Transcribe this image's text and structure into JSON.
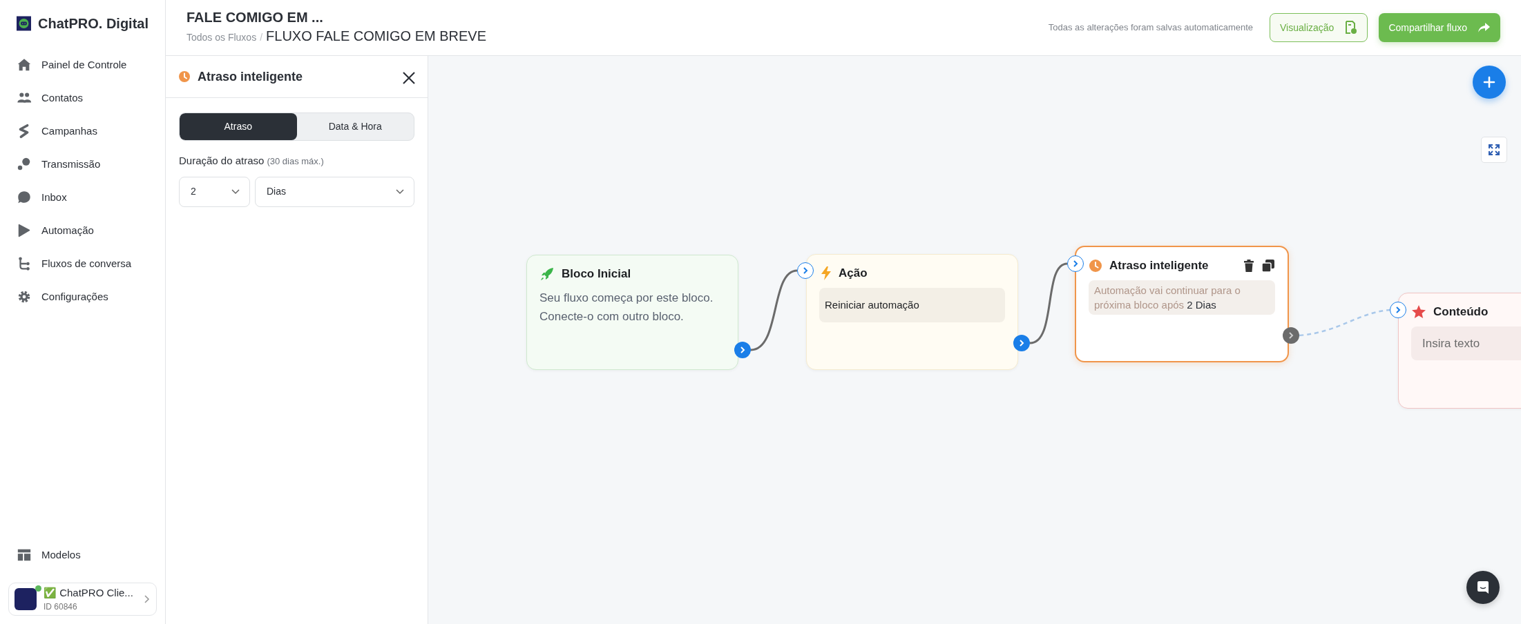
{
  "sidebar": {
    "brand": "ChatPRO. Digital",
    "items": [
      {
        "label": "Painel de Controle"
      },
      {
        "label": "Contatos"
      },
      {
        "label": "Campanhas"
      },
      {
        "label": "Transmissão"
      },
      {
        "label": "Inbox"
      },
      {
        "label": "Automação"
      },
      {
        "label": "Fluxos de conversa"
      },
      {
        "label": "Configurações"
      }
    ],
    "bottom_items": [
      {
        "label": "Modelos"
      }
    ],
    "account": {
      "name": "✅ ChatPRO Clie...",
      "id": "ID 60846",
      "online": true
    }
  },
  "header": {
    "title": "FALE COMIGO EM ...",
    "breadcrumb_separator": "/",
    "breadcrumb": [
      {
        "label": "Todos os Fluxos"
      },
      {
        "label": "FLUXO FALE COMIGO EM BREVE"
      }
    ],
    "save_status": "Todas as alterações foram salvas automaticamente",
    "buttons": [
      {
        "kind": "outline",
        "label": "Visualização"
      },
      {
        "kind": "primary",
        "label": "Compartilhar fluxo"
      }
    ]
  },
  "panel": {
    "title": "Atraso inteligente",
    "tabs": [
      {
        "label": "Atraso",
        "selected": true
      },
      {
        "label": "Data & Hora",
        "selected": false
      }
    ],
    "field_label": "Duração do atraso",
    "field_hint": "(30 dias máx.)",
    "selects": [
      {
        "value": "2"
      },
      {
        "value": "Dias"
      }
    ]
  },
  "canvas": {
    "nodes": [
      {
        "kind": "start",
        "title": "Bloco Inicial",
        "text": "Seu fluxo começa por este bloco. Conecte-o com outro bloco.",
        "selected": false
      },
      {
        "kind": "action",
        "title": "Ação",
        "body": "Reiniciar automação",
        "selected": false
      },
      {
        "kind": "delay",
        "title": "Atraso inteligente",
        "body": "Automação vai continuar para o próxima bloco após",
        "value": "2 Dias",
        "selected": true
      },
      {
        "kind": "content",
        "title": "Conteúdo",
        "placeholder": "Insira texto",
        "selected": false
      }
    ],
    "edges": [
      {
        "kind": "solid"
      },
      {
        "kind": "solid"
      },
      {
        "kind": "dashed"
      }
    ]
  }
}
